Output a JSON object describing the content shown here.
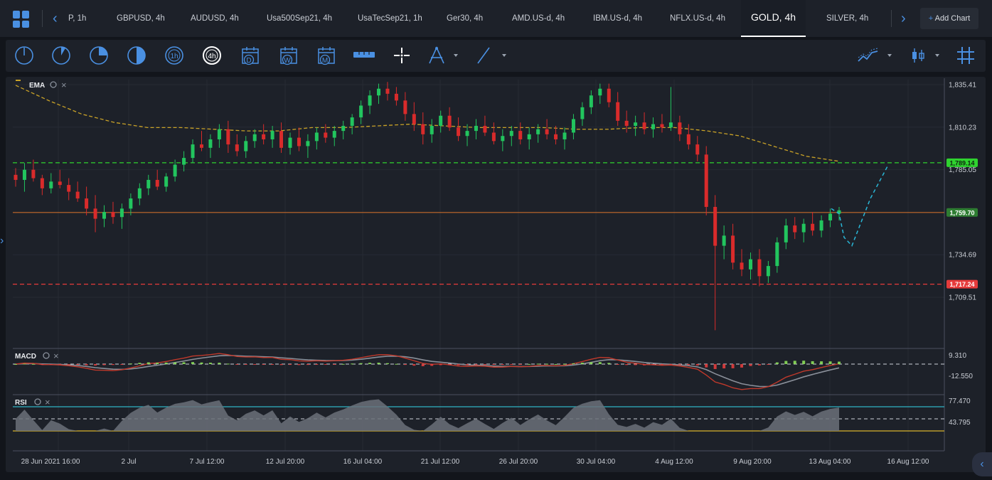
{
  "tabs": [
    {
      "label": "P, 1h"
    },
    {
      "label": "GBPUSD, 4h"
    },
    {
      "label": "AUDUSD, 4h"
    },
    {
      "label": "Usa500Sep21, 4h"
    },
    {
      "label": "UsaTecSep21, 1h"
    },
    {
      "label": "Ger30, 4h"
    },
    {
      "label": "AMD.US-d, 4h"
    },
    {
      "label": "IBM.US-d, 4h"
    },
    {
      "label": "NFLX.US-d, 4h"
    },
    {
      "label": "GOLD, 4h"
    },
    {
      "label": "SILVER, 4h"
    }
  ],
  "active_tab": "GOLD, 4h",
  "add_chart": {
    "icon": "+",
    "label": "Add Chart"
  },
  "toolbar": {
    "timeframe_icons": [
      "1m-clock-icon",
      "5m-clock-icon",
      "15m-clock-icon",
      "30m-clock-icon",
      "1h-clock-icon",
      "4h-clock-icon"
    ],
    "timeframe_labels": {
      "h1": "1h",
      "h4": "4h"
    },
    "period_icons": [
      {
        "name": "daily-calendar-icon",
        "label": "D"
      },
      {
        "name": "weekly-calendar-icon",
        "label": "W"
      },
      {
        "name": "monthly-calendar-icon",
        "label": "M"
      }
    ],
    "tools": [
      "ruler-icon",
      "crosshair-icon",
      "drawing-tools-icon",
      "trendline-icon"
    ],
    "right_tools": [
      "indicators-icon",
      "chart-type-icon",
      "grid-icon"
    ]
  },
  "colors": {
    "up": "#22c55e",
    "down": "#d92b2b",
    "ema": "#c9a227",
    "accent": "#4a90e2",
    "green_level": "#2fd32f",
    "red_level": "#e63b3b",
    "orange_level": "#c76b2a",
    "projection": "#29b6d6",
    "rsi_band": "#2fb3c4",
    "rsi_low": "#d8b32b",
    "macd_up": "#8de05a",
    "macd_down": "#e23d3d"
  },
  "chart_data": {
    "type": "candlestick",
    "symbol": "GOLD",
    "timeframe": "4h",
    "x_labels": [
      "28 Jun 2021 16:00",
      "2 Jul",
      "7 Jul 12:00",
      "12 Jul 20:00",
      "16 Jul 04:00",
      "21 Jul 12:00",
      "26 Jul 20:00",
      "30 Jul 04:00",
      "4 Aug 12:00",
      "9 Aug 20:00",
      "13 Aug 04:00",
      "16 Aug 12:00"
    ],
    "y_ticks": [
      "1,835.41",
      "1,810.23",
      "1,785.05",
      "1,734.69",
      "1,709.51"
    ],
    "ylim": [
      1682,
      1838
    ],
    "indicator": {
      "label": "EMA"
    },
    "ema": [
      1835,
      1826,
      1818,
      1813,
      1810,
      1810,
      1809,
      1808,
      1808,
      1810,
      1810,
      1811,
      1812,
      1811,
      1810,
      1810,
      1810,
      1809,
      1809,
      1810,
      1810,
      1808,
      1805,
      1799,
      1793,
      1790
    ],
    "levels": [
      {
        "label": "1,789.14",
        "value": 1789.14,
        "style": "dashed",
        "color": "#2fd32f"
      },
      {
        "label": "1,759.70",
        "value": 1759.7,
        "style": "solid",
        "color": "#c76b2a"
      },
      {
        "label": "1,717.24",
        "value": 1717.24,
        "style": "dashed",
        "color": "#e63b3b"
      }
    ],
    "projection": [
      [
        1169,
        1762
      ],
      [
        1180,
        1759
      ],
      [
        1187,
        1745
      ],
      [
        1198,
        1740
      ],
      [
        1224,
        1768
      ],
      [
        1248,
        1787
      ]
    ],
    "candles": [
      [
        1782,
        1786,
        1775,
        1779
      ],
      [
        1779,
        1789,
        1772,
        1785
      ],
      [
        1785,
        1791,
        1778,
        1780
      ],
      [
        1780,
        1782,
        1770,
        1774
      ],
      [
        1774,
        1783,
        1771,
        1778
      ],
      [
        1778,
        1785,
        1774,
        1776
      ],
      [
        1776,
        1780,
        1767,
        1772
      ],
      [
        1772,
        1778,
        1766,
        1768
      ],
      [
        1768,
        1775,
        1758,
        1762
      ],
      [
        1762,
        1770,
        1748,
        1756
      ],
      [
        1756,
        1764,
        1751,
        1760
      ],
      [
        1760,
        1766,
        1753,
        1757
      ],
      [
        1757,
        1765,
        1750,
        1762
      ],
      [
        1762,
        1771,
        1758,
        1768
      ],
      [
        1768,
        1777,
        1764,
        1774
      ],
      [
        1774,
        1782,
        1770,
        1779
      ],
      [
        1779,
        1785,
        1773,
        1775
      ],
      [
        1775,
        1783,
        1772,
        1781
      ],
      [
        1781,
        1791,
        1778,
        1788
      ],
      [
        1788,
        1796,
        1784,
        1792
      ],
      [
        1792,
        1803,
        1789,
        1800
      ],
      [
        1800,
        1808,
        1796,
        1798
      ],
      [
        1798,
        1806,
        1792,
        1803
      ],
      [
        1803,
        1812,
        1798,
        1809
      ],
      [
        1809,
        1814,
        1795,
        1800
      ],
      [
        1800,
        1806,
        1793,
        1796
      ],
      [
        1796,
        1805,
        1792,
        1802
      ],
      [
        1802,
        1809,
        1798,
        1806
      ],
      [
        1806,
        1812,
        1800,
        1803
      ],
      [
        1803,
        1811,
        1798,
        1808
      ],
      [
        1808,
        1813,
        1795,
        1798
      ],
      [
        1798,
        1807,
        1794,
        1804
      ],
      [
        1804,
        1810,
        1796,
        1799
      ],
      [
        1799,
        1806,
        1792,
        1802
      ],
      [
        1802,
        1810,
        1797,
        1807
      ],
      [
        1807,
        1812,
        1801,
        1804
      ],
      [
        1804,
        1811,
        1799,
        1808
      ],
      [
        1808,
        1814,
        1803,
        1811
      ],
      [
        1811,
        1818,
        1806,
        1816
      ],
      [
        1816,
        1826,
        1812,
        1823
      ],
      [
        1823,
        1832,
        1818,
        1829
      ],
      [
        1829,
        1836,
        1824,
        1833
      ],
      [
        1833,
        1837,
        1826,
        1830
      ],
      [
        1830,
        1834,
        1823,
        1826
      ],
      [
        1826,
        1831,
        1814,
        1818
      ],
      [
        1818,
        1825,
        1808,
        1812
      ],
      [
        1812,
        1819,
        1800,
        1806
      ],
      [
        1806,
        1815,
        1801,
        1811
      ],
      [
        1811,
        1820,
        1807,
        1817
      ],
      [
        1817,
        1822,
        1808,
        1810
      ],
      [
        1810,
        1816,
        1802,
        1805
      ],
      [
        1805,
        1812,
        1799,
        1808
      ],
      [
        1808,
        1815,
        1803,
        1811
      ],
      [
        1811,
        1817,
        1805,
        1807
      ],
      [
        1807,
        1813,
        1800,
        1802
      ],
      [
        1802,
        1809,
        1796,
        1805
      ],
      [
        1805,
        1811,
        1799,
        1808
      ],
      [
        1808,
        1813,
        1800,
        1803
      ],
      [
        1803,
        1810,
        1797,
        1806
      ],
      [
        1806,
        1812,
        1801,
        1809
      ],
      [
        1809,
        1815,
        1803,
        1806
      ],
      [
        1806,
        1811,
        1800,
        1803
      ],
      [
        1803,
        1810,
        1797,
        1807
      ],
      [
        1807,
        1818,
        1803,
        1815
      ],
      [
        1815,
        1825,
        1811,
        1822
      ],
      [
        1822,
        1832,
        1818,
        1829
      ],
      [
        1829,
        1836,
        1824,
        1833
      ],
      [
        1833,
        1836,
        1822,
        1825
      ],
      [
        1825,
        1831,
        1811,
        1814
      ],
      [
        1814,
        1820,
        1807,
        1811
      ],
      [
        1811,
        1817,
        1805,
        1813
      ],
      [
        1813,
        1819,
        1806,
        1809
      ],
      [
        1809,
        1816,
        1804,
        1812
      ],
      [
        1812,
        1818,
        1807,
        1810
      ],
      [
        1810,
        1834,
        1808,
        1813
      ],
      [
        1813,
        1817,
        1802,
        1806
      ],
      [
        1806,
        1812,
        1797,
        1800
      ],
      [
        1800,
        1805,
        1790,
        1794
      ],
      [
        1794,
        1799,
        1758,
        1763
      ],
      [
        1763,
        1770,
        1690,
        1740
      ],
      [
        1740,
        1752,
        1732,
        1746
      ],
      [
        1746,
        1753,
        1726,
        1730
      ],
      [
        1730,
        1738,
        1722,
        1726
      ],
      [
        1726,
        1736,
        1720,
        1732
      ],
      [
        1732,
        1738,
        1716,
        1722
      ],
      [
        1722,
        1731,
        1718,
        1728
      ],
      [
        1728,
        1745,
        1724,
        1742
      ],
      [
        1742,
        1756,
        1738,
        1752
      ],
      [
        1752,
        1757,
        1744,
        1748
      ],
      [
        1748,
        1756,
        1742,
        1753
      ],
      [
        1753,
        1760,
        1746,
        1749
      ],
      [
        1749,
        1758,
        1745,
        1755
      ],
      [
        1755,
        1762,
        1751,
        1759
      ],
      [
        1759,
        1763,
        1755,
        1761
      ]
    ],
    "macd": {
      "label": "MACD",
      "ticks": [
        "9.310",
        "-12.550"
      ]
    },
    "rsi": {
      "label": "RSI",
      "ticks": [
        "77.470",
        "43.795"
      ]
    }
  }
}
